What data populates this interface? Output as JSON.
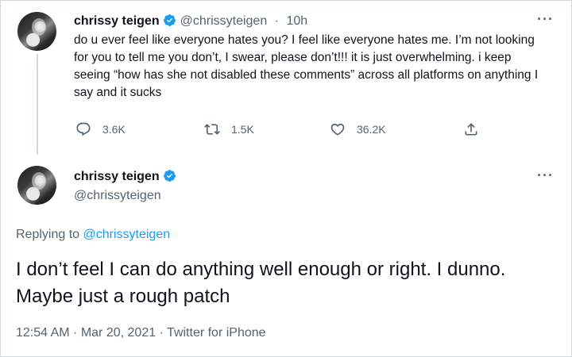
{
  "tweet1": {
    "display_name": "chrissy teigen",
    "handle": "@chrissyteigen",
    "separator": "·",
    "time": "10h",
    "more": "···",
    "text": "do u ever feel like everyone hates you? I feel like everyone hates me. I’m not looking for you to tell me you don’t, I swear, please don’t!!! it is just overwhelming. i keep seeing “how has she not disabled these comments” across all platforms on anything I say and it sucks",
    "replies": "3.6K",
    "retweets": "1.5K",
    "likes": "36.2K",
    "icons": [
      "reply-icon",
      "retweet-icon",
      "like-icon",
      "share-icon"
    ]
  },
  "tweet2": {
    "display_name": "chrissy teigen",
    "handle": "@chrissyteigen",
    "more": "···",
    "replying_prefix": "Replying to ",
    "replying_to": "@chrissyteigen",
    "text": "I don’t feel I can do anything well enough or right. I dunno. Maybe just a rough patch",
    "time": "12:54 AM",
    "separator1": " · ",
    "date": "Mar 20, 2021",
    "separator2": " · ",
    "source": "Twitter for iPhone"
  },
  "colors": {
    "accent": "#1d9bf0",
    "secondary_text": "#536471",
    "primary_text": "#0f1419",
    "divider": "#cfd9de"
  }
}
